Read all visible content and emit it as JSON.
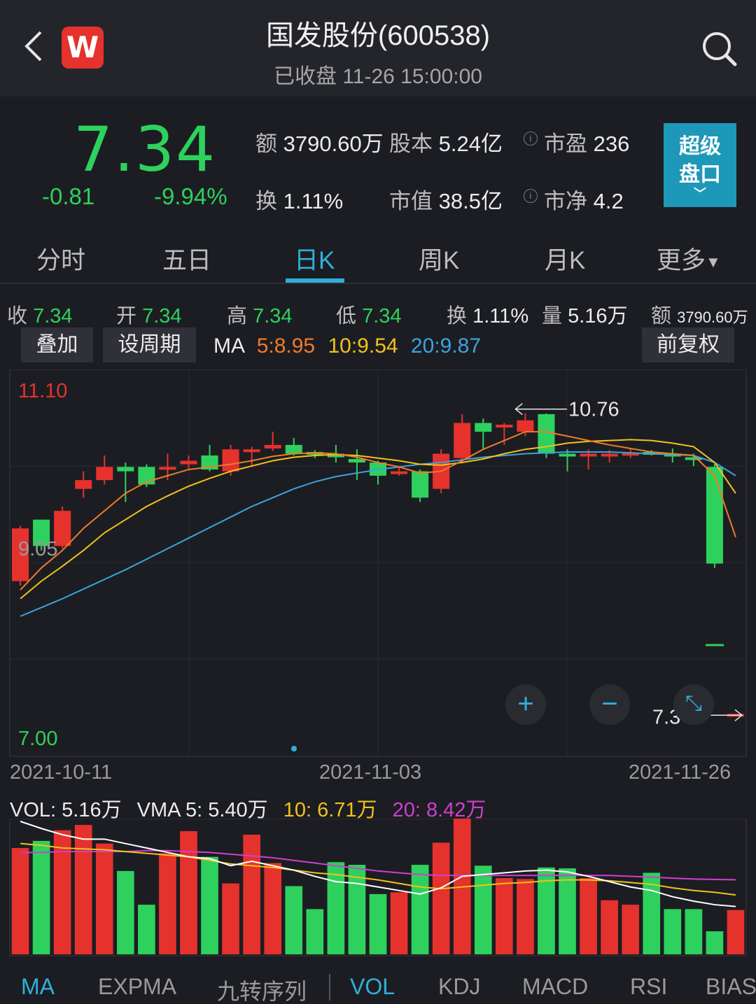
{
  "header": {
    "title": "国发股份(600538)",
    "status": "已收盘 11-26 15:00:00",
    "logo_letter": "W"
  },
  "quote": {
    "price": "7.34",
    "change": "-0.81",
    "change_pct": "-9.94%",
    "amount_label": "额",
    "amount": "3790.60万",
    "capital_label": "股本",
    "capital": "5.24亿",
    "pe_label": "市盈",
    "pe": "236",
    "turnover_label": "换",
    "turnover": "1.11%",
    "mktcap_label": "市值",
    "mktcap": "38.5亿",
    "pb_label": "市净",
    "pb": "4.2",
    "info_glyph": "i",
    "super_btn_line1": "超级",
    "super_btn_line2": "盘口"
  },
  "tabs": [
    {
      "label": "分时"
    },
    {
      "label": "五日"
    },
    {
      "label": "日K"
    },
    {
      "label": "周K"
    },
    {
      "label": "月K"
    },
    {
      "label": "更多"
    }
  ],
  "ohlc": {
    "close_label": "收",
    "close": "7.34",
    "open_label": "开",
    "open": "7.34",
    "high_label": "高",
    "high": "7.34",
    "low_label": "低",
    "low": "7.34",
    "turn_label": "换",
    "turn": "1.11%",
    "vol_label": "量",
    "vol": "5.16万",
    "amt_label": "额",
    "amt": "3790.60万"
  },
  "toolbar": {
    "overlay": "叠加",
    "period": "设周期",
    "adjust": "前复权",
    "ma_label": "MA",
    "ma5": "5:8.95",
    "ma10": "10:9.54",
    "ma20": "20:9.87"
  },
  "colors": {
    "up": "#e5322d",
    "down": "#2ed15d",
    "ma5": "#f07a2a",
    "ma10": "#f1c21b",
    "ma20": "#3aa3e0",
    "accent": "#2fb0db",
    "vma20": "#d03fd0"
  },
  "chart_data": {
    "type": "candlestick",
    "ylim": [
      7.0,
      11.1
    ],
    "y_labels": {
      "top": "11.10",
      "mid": "9.05",
      "bottom": "7.00"
    },
    "max_label": "10.76",
    "last_label": "7.34",
    "dates": [
      "2021-10-11",
      "2021-11-03",
      "2021-11-26"
    ],
    "candles": [
      [
        8.85,
        9.45,
        9.48,
        8.8
      ],
      [
        9.55,
        9.25,
        9.2,
        9.28
      ],
      [
        9.25,
        9.65,
        9.7,
        9.22
      ],
      [
        9.9,
        10.0,
        10.1,
        9.8
      ],
      [
        10.0,
        10.15,
        10.28,
        9.95
      ],
      [
        10.15,
        10.1,
        10.2,
        9.75
      ],
      [
        10.15,
        9.95,
        10.18,
        9.92
      ],
      [
        10.12,
        10.15,
        10.3,
        10.0
      ],
      [
        10.18,
        10.22,
        10.28,
        10.12
      ],
      [
        10.28,
        10.12,
        10.4,
        10.1
      ],
      [
        10.1,
        10.35,
        10.4,
        10.05
      ],
      [
        10.35,
        10.35,
        10.38,
        10.15
      ],
      [
        10.36,
        10.4,
        10.55,
        10.33
      ],
      [
        10.4,
        10.3,
        10.48,
        10.28
      ],
      [
        10.32,
        10.3,
        10.34,
        10.25
      ],
      [
        10.3,
        10.26,
        10.4,
        10.2
      ],
      [
        10.24,
        10.2,
        10.35,
        10.0
      ],
      [
        10.2,
        10.05,
        10.22,
        9.95
      ],
      [
        10.1,
        10.1,
        10.15,
        10.05
      ],
      [
        10.1,
        9.8,
        10.12,
        9.75
      ],
      [
        9.9,
        10.3,
        10.35,
        9.85
      ],
      [
        10.25,
        10.65,
        10.75,
        10.2
      ],
      [
        10.65,
        10.55,
        10.7,
        10.35
      ],
      [
        10.6,
        10.63,
        10.65,
        10.4
      ],
      [
        10.55,
        10.68,
        10.76,
        10.5
      ],
      [
        10.75,
        10.3,
        10.76,
        10.25
      ],
      [
        10.3,
        10.28,
        10.35,
        10.1
      ],
      [
        10.3,
        10.3,
        10.35,
        10.12
      ],
      [
        10.3,
        10.3,
        10.34,
        10.2
      ],
      [
        10.3,
        10.31,
        10.35,
        10.25
      ],
      [
        10.32,
        10.3,
        10.34,
        10.28
      ],
      [
        10.3,
        10.28,
        10.36,
        10.2
      ],
      [
        10.26,
        10.24,
        10.3,
        10.16
      ],
      [
        10.15,
        9.05,
        10.18,
        9.0
      ],
      [
        7.34,
        7.34,
        7.34,
        7.34
      ]
    ],
    "ma5": [
      8.75,
      9.0,
      9.2,
      9.45,
      9.65,
      9.85,
      9.98,
      10.05,
      10.12,
      10.15,
      10.18,
      10.22,
      10.27,
      10.3,
      10.31,
      10.3,
      10.26,
      10.2,
      10.15,
      10.08,
      10.1,
      10.22,
      10.35,
      10.45,
      10.55,
      10.55,
      10.5,
      10.45,
      10.4,
      10.36,
      10.32,
      10.3,
      10.28,
      10.05,
      9.35
    ],
    "ma10": [
      8.65,
      8.85,
      9.02,
      9.2,
      9.4,
      9.55,
      9.7,
      9.82,
      9.93,
      10.02,
      10.1,
      10.16,
      10.22,
      10.26,
      10.28,
      10.29,
      10.28,
      10.25,
      10.22,
      10.18,
      10.17,
      10.2,
      10.24,
      10.3,
      10.35,
      10.38,
      10.42,
      10.44,
      10.45,
      10.46,
      10.45,
      10.42,
      10.38,
      10.2,
      9.85
    ],
    "ma20": [
      8.45,
      8.55,
      8.65,
      8.76,
      8.87,
      8.98,
      9.1,
      9.22,
      9.34,
      9.46,
      9.58,
      9.7,
      9.8,
      9.9,
      9.98,
      10.04,
      10.08,
      10.12,
      10.15,
      10.18,
      10.2,
      10.23,
      10.26,
      10.28,
      10.3,
      10.31,
      10.32,
      10.32,
      10.32,
      10.31,
      10.3,
      10.29,
      10.28,
      10.2,
      10.05
    ],
    "volume": {
      "vol_label": "VOL: 5.16万",
      "vma5": "VMA 5: 5.40万",
      "vma10": "10: 6.71万",
      "vma20": "20: 8.42万",
      "values": [
        12.0,
        12.8,
        14.0,
        14.6,
        12.5,
        9.4,
        5.6,
        11.4,
        13.9,
        11.0,
        8.0,
        13.5,
        10.3,
        7.7,
        5.1,
        10.4,
        10.1,
        6.8,
        7.0,
        10.1,
        12.6,
        16.1,
        10.0,
        8.6,
        8.5,
        9.8,
        9.7,
        8.6,
        6.1,
        5.6,
        9.2,
        5.1,
        5.1,
        2.6,
        5.0
      ],
      "vma5_line": [
        15.0,
        14.2,
        13.5,
        13.0,
        13.0,
        12.5,
        12.0,
        11.5,
        11.0,
        10.8,
        10.0,
        10.5,
        10.0,
        9.5,
        8.8,
        8.2,
        8.0,
        7.6,
        7.2,
        6.8,
        7.5,
        8.8,
        9.0,
        9.2,
        9.4,
        9.5,
        9.3,
        8.8,
        8.2,
        7.6,
        7.2,
        6.5,
        6.0,
        5.6,
        5.4
      ],
      "vma10_line": [
        12.5,
        12.3,
        12.0,
        11.9,
        11.8,
        11.6,
        11.4,
        11.2,
        11.0,
        10.6,
        10.2,
        10.0,
        9.8,
        9.5,
        9.2,
        9.0,
        8.7,
        8.4,
        8.0,
        7.6,
        7.4,
        7.6,
        7.8,
        8.0,
        8.1,
        8.3,
        8.4,
        8.4,
        8.3,
        8.1,
        7.9,
        7.5,
        7.2,
        7.0,
        6.7
      ],
      "vma20_line": [
        11.5,
        11.5,
        11.6,
        11.6,
        11.6,
        11.6,
        11.7,
        11.7,
        11.6,
        11.5,
        11.3,
        11.1,
        10.9,
        10.6,
        10.3,
        10.0,
        9.7,
        9.4,
        9.2,
        9.0,
        8.9,
        8.9,
        8.9,
        8.9,
        8.9,
        8.9,
        8.9,
        8.9,
        8.9,
        8.8,
        8.7,
        8.6,
        8.5,
        8.45,
        8.42
      ],
      "vmax": 15.0
    }
  },
  "bottom_tabs": [
    {
      "label": "MA",
      "active": true
    },
    {
      "label": "EXPMA",
      "active": false
    },
    {
      "label": "九转序列",
      "active": false
    },
    {
      "label": "VOL",
      "active": true
    },
    {
      "label": "KDJ",
      "active": false
    },
    {
      "label": "MACD",
      "active": false
    },
    {
      "label": "RSI",
      "active": false
    },
    {
      "label": "BIAS",
      "active": false
    }
  ],
  "zoom": {
    "plus": "+",
    "minus": "−",
    "expand": "⤡"
  }
}
